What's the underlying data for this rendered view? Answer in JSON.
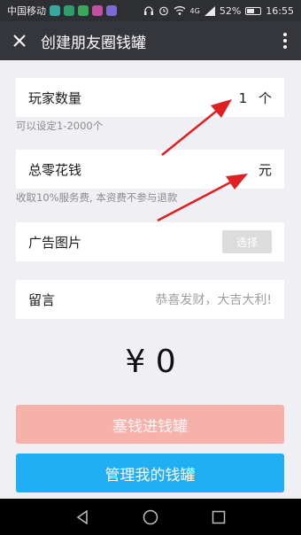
{
  "status_bar": {
    "carrier": "中国移动",
    "network": "4G",
    "battery": "52%",
    "time": "16:55",
    "app_icon_colors": [
      "#3aa7a0",
      "#2e9e6e",
      "#3aa960",
      "#c2509e",
      "#7b6ad1"
    ]
  },
  "header": {
    "title": "创建朋友圈钱罐",
    "close_icon": "close-icon",
    "more_icon": "more-vertical-icon"
  },
  "form": {
    "players": {
      "label": "玩家数量",
      "value": "1",
      "unit": "个"
    },
    "players_hint": "可以设定1-2000个",
    "total": {
      "label": "总零花钱",
      "unit": "元"
    },
    "total_hint": "收取10%服务费, 本资费不参与退款",
    "ad_image": {
      "label": "广告图片",
      "button": "选择"
    },
    "message": {
      "label": "留言",
      "placeholder": "恭喜发财，大吉大利!"
    }
  },
  "amount": "¥ 0",
  "buttons": {
    "deposit": "塞钱进钱罐",
    "manage": "管理我的钱罐"
  },
  "colors": {
    "header_bg": "#35363b",
    "deposit_disabled": "#f7b1ab",
    "manage_blue": "#20aef5",
    "annotation_arrow": "#e02020"
  }
}
